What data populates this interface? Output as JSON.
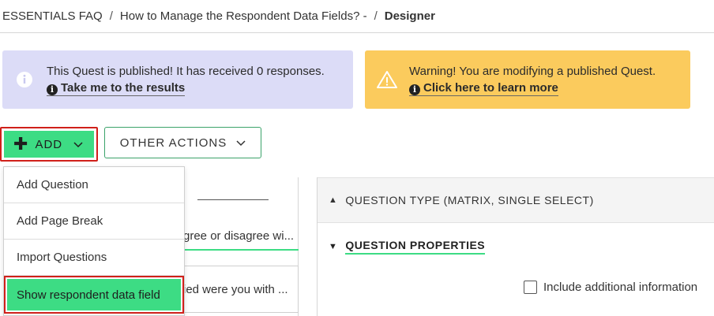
{
  "breadcrumb": {
    "items": [
      "ESSENTIALS FAQ",
      "How to Manage the Respondent Data Fields? -",
      "Designer"
    ],
    "separator": "/"
  },
  "alerts": {
    "info": {
      "message": "This Quest is published! It has received 0 responses.",
      "link": "Take me to the results",
      "icon": "info-circle-icon",
      "color": "#dcdcf7"
    },
    "warning": {
      "message": "Warning! You are modifying a published Quest.",
      "link": "Click here to learn more",
      "icon": "warning-triangle-icon",
      "color": "#fbcb5d"
    }
  },
  "toolbar": {
    "add_label": "ADD",
    "other_actions_label": "OTHER ACTIONS",
    "accent": "#3ddc84"
  },
  "dropdown": {
    "items": [
      "Add Question",
      "Add Page Break",
      "Import Questions",
      "Show respondent data field"
    ]
  },
  "left_panel": {
    "question_1": "gree or disagree wi...",
    "question_2": "ied were you with ..."
  },
  "right_panel": {
    "question_type": "QUESTION TYPE (MATRIX, SINGLE SELECT)",
    "question_properties": "QUESTION PROPERTIES",
    "include_label": "Include additional information"
  }
}
